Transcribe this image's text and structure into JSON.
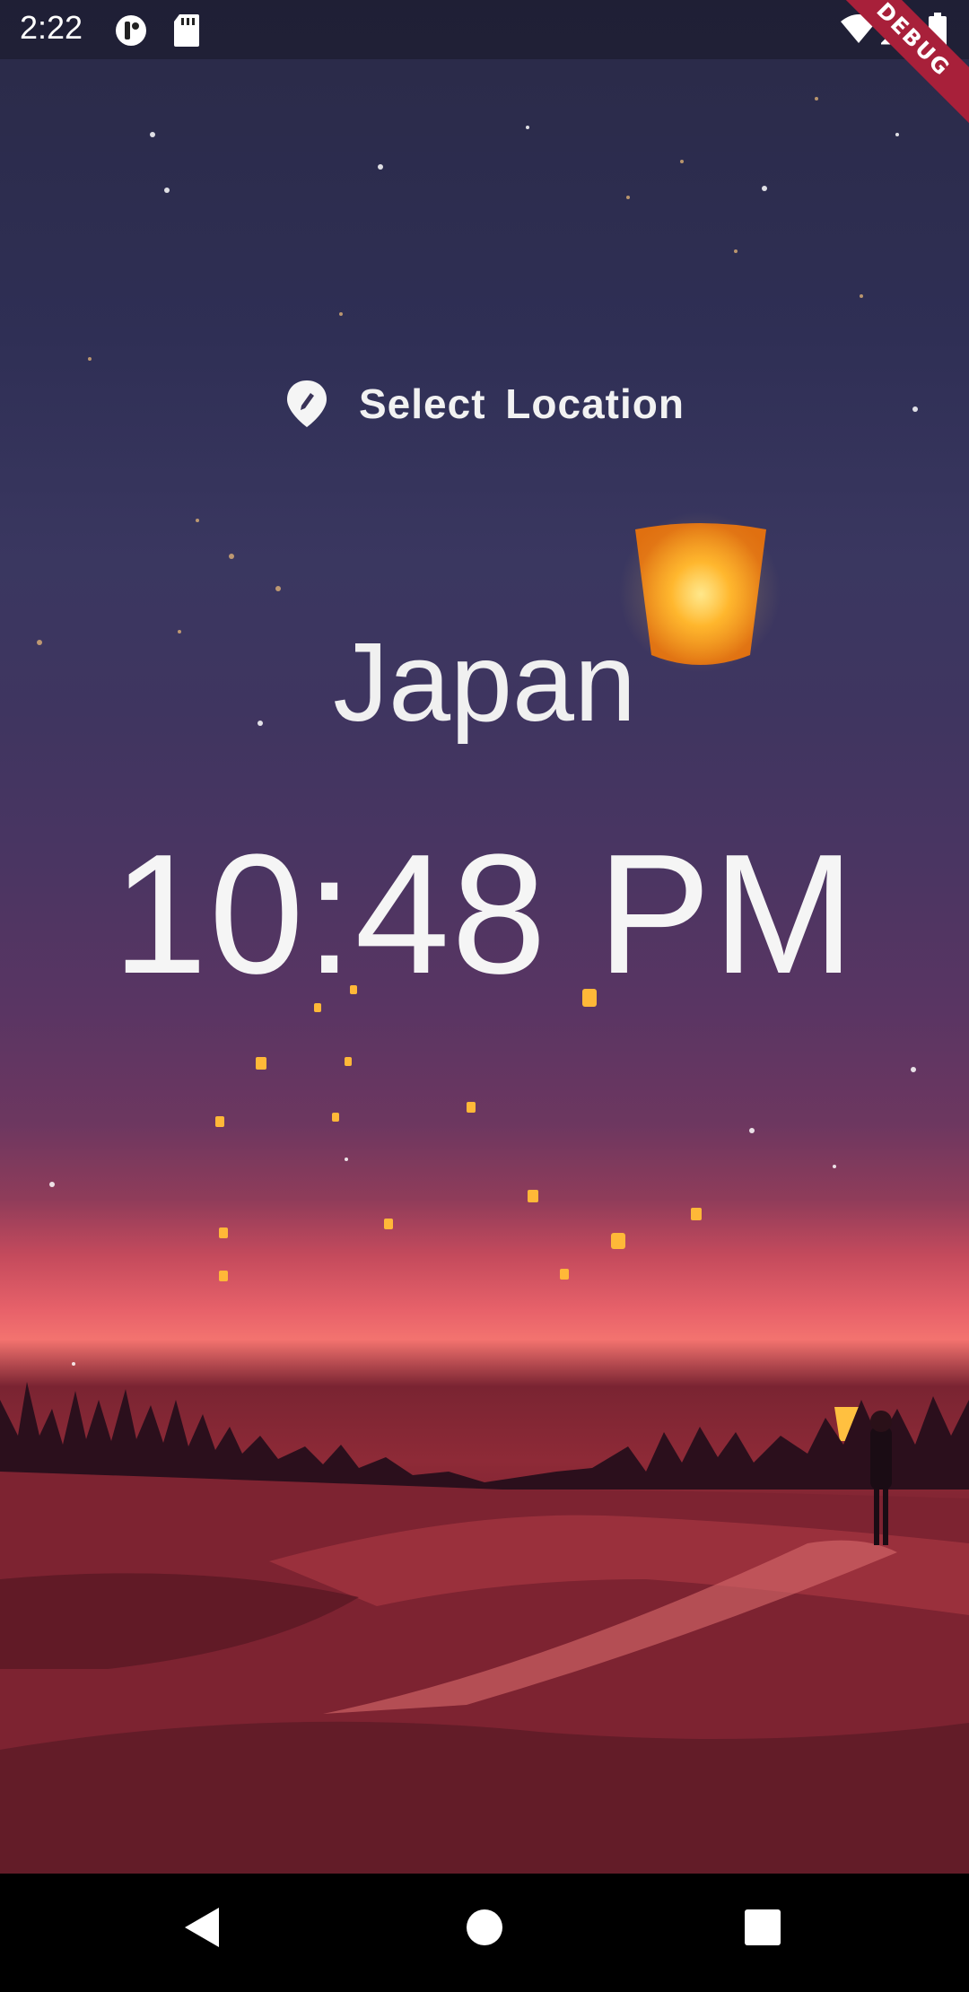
{
  "status_bar": {
    "time": "2:22",
    "icons": [
      "notification-app-icon",
      "sd-card-icon",
      "wifi-icon",
      "signal-icon",
      "battery-icon"
    ]
  },
  "debug_banner": "DEBUG",
  "location_selector": {
    "label": "Select  Location",
    "icon": "location-pin-icon"
  },
  "location": "Japan",
  "time": "10:48 PM",
  "nav_bar": {
    "buttons": [
      "back-icon",
      "home-icon",
      "recents-icon"
    ]
  },
  "colors": {
    "sky_top": "#2a2a47",
    "horizon_glow": "#f3736f",
    "ground": "#8e2a37",
    "lantern": "#ffb020"
  }
}
